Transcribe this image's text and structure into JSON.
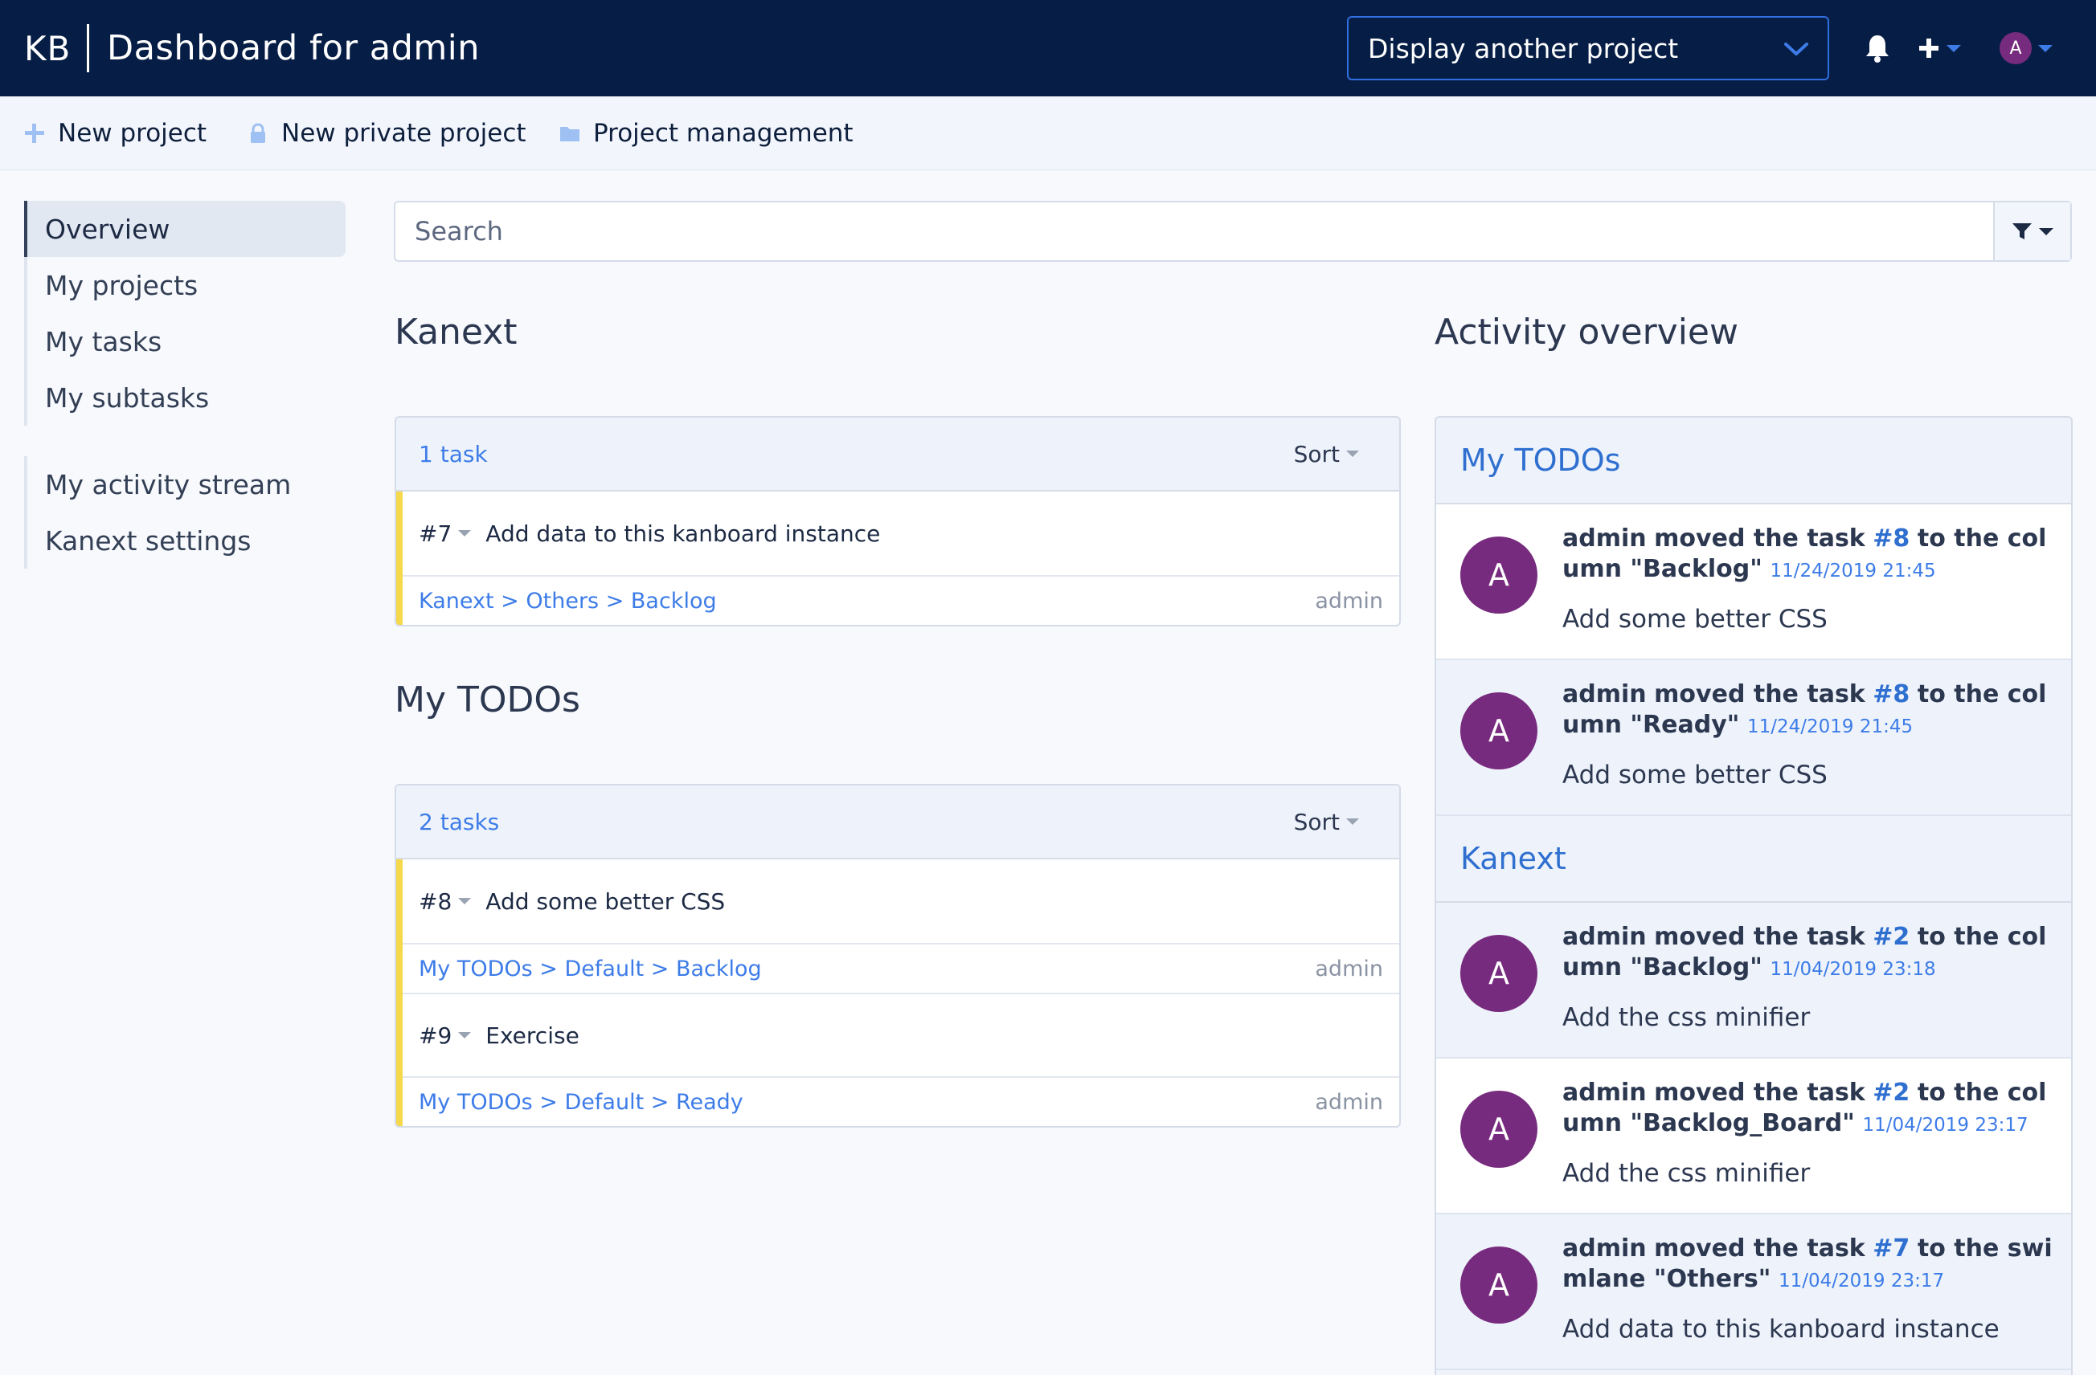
{
  "header": {
    "logo": "KB",
    "title": "Dashboard for admin",
    "project_select": "Display another project",
    "avatar_letter": "A"
  },
  "actions": {
    "new_project": "New project",
    "new_private_project": "New private project",
    "project_management": "Project management"
  },
  "sidebar": {
    "main": [
      "Overview",
      "My projects",
      "My tasks",
      "My subtasks"
    ],
    "secondary": [
      "My activity stream",
      "Kanext settings"
    ]
  },
  "search": {
    "placeholder": "Search"
  },
  "sections": {
    "kanext": {
      "title": "Kanext",
      "count": "1 task",
      "sort": "Sort",
      "tasks": [
        {
          "id": "#7",
          "title": "Add data to this kanboard instance",
          "path": "Kanext > Others > Backlog",
          "owner": "admin"
        }
      ]
    },
    "todos": {
      "title": "My TODOs",
      "count": "2 tasks",
      "sort": "Sort",
      "tasks": [
        {
          "id": "#8",
          "title": "Add some better CSS",
          "path": "My TODOs > Default > Backlog",
          "owner": "admin"
        },
        {
          "id": "#9",
          "title": "Exercise",
          "path": "My TODOs > Default > Ready",
          "owner": "admin"
        }
      ]
    }
  },
  "activity": {
    "title": "Activity overview",
    "groups": [
      {
        "name": "My TODOs",
        "items": [
          {
            "avatar": "A",
            "user": "admin",
            "action": "moved the task",
            "task": "#8",
            "dest": "to the column \"Backlog\"",
            "date": "11/24/2019 21:45",
            "task_title": "Add some better CSS"
          },
          {
            "avatar": "A",
            "user": "admin",
            "action": "moved the task",
            "task": "#8",
            "dest": "to the column \"Ready\"",
            "date": "11/24/2019 21:45",
            "task_title": "Add some better CSS"
          }
        ]
      },
      {
        "name": "Kanext",
        "items": [
          {
            "avatar": "A",
            "user": "admin",
            "action": "moved the task",
            "task": "#2",
            "dest": "to the column \"Backlog\"",
            "date": "11/04/2019 23:18",
            "task_title": "Add the css minifier"
          },
          {
            "avatar": "A",
            "user": "admin",
            "action": "moved the task",
            "task": "#2",
            "dest": "to the column \"Backlog_Board\"",
            "date": "11/04/2019 23:17",
            "task_title": "Add the css minifier"
          },
          {
            "avatar": "A",
            "user": "admin",
            "action": "moved the task",
            "task": "#7",
            "dest": "to the swimlane \"Others\"",
            "date": "11/04/2019 23:17",
            "task_title": "Add data to this kanboard instance"
          }
        ]
      }
    ]
  },
  "colors": {
    "header_bg": "#061d45",
    "accent": "#3d7ce8",
    "avatar": "#772b7e",
    "task_stripe": "#f5d94a"
  }
}
